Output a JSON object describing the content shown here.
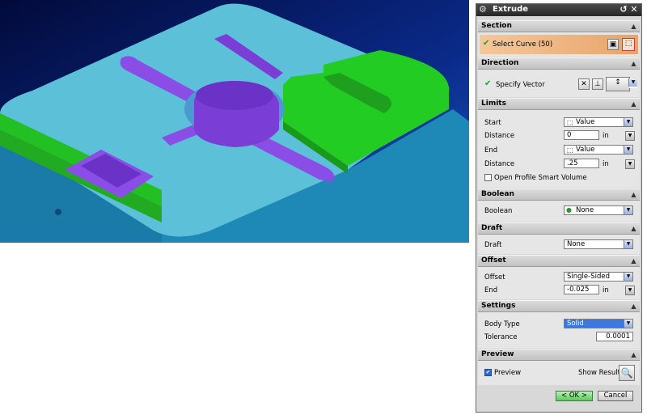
{
  "viewport": {
    "background": "#0a1a6a",
    "description_icon": "3d-model-icon"
  },
  "dialog": {
    "title": "Extrude",
    "sections": {
      "section": {
        "label": "Section",
        "select_curve": "Select Curve (50)"
      },
      "direction": {
        "label": "Direction",
        "specify_vector": "Specify Vector"
      },
      "limits": {
        "label": "Limits",
        "start_label": "Start",
        "start_value": "Value",
        "distance1_label": "Distance",
        "distance1_value": "0",
        "distance1_unit": "in",
        "end_label": "End",
        "end_value": "Value",
        "distance2_label": "Distance",
        "distance2_value": ".25",
        "distance2_unit": "in",
        "open_profile": "Open Profile Smart Volume"
      },
      "boolean": {
        "label": "Boolean",
        "row_label": "Boolean",
        "value": "None"
      },
      "draft": {
        "label": "Draft",
        "row_label": "Draft",
        "value": "None"
      },
      "offset": {
        "label": "Offset",
        "row_label": "Offset",
        "value": "Single-Sided",
        "end_label": "End",
        "end_value": "-0.025",
        "end_unit": "in"
      },
      "settings": {
        "label": "Settings",
        "body_type_label": "Body Type",
        "body_type_value": "Solid",
        "tolerance_label": "Tolerance",
        "tolerance_value": "0.0001"
      },
      "preview": {
        "label": "Preview",
        "checkbox_label": "Preview",
        "show_result": "Show Result"
      }
    },
    "buttons": {
      "ok": "< OK >",
      "cancel": "Cancel"
    }
  },
  "colors": {
    "face_cyan": "#5bc0d8",
    "face_green": "#22cc22",
    "face_purple": "#8a4ee6",
    "section_orange": "#f0b27a"
  }
}
